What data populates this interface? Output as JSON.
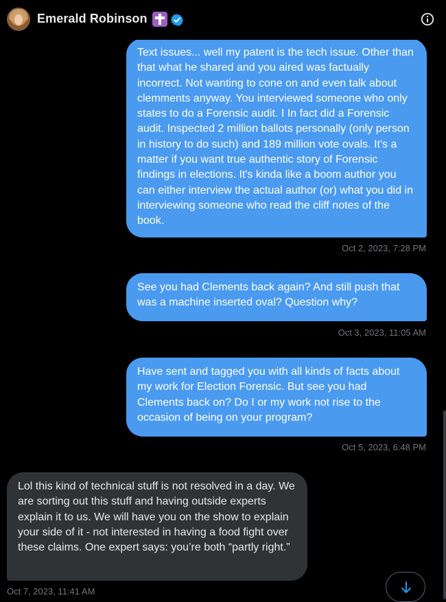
{
  "header": {
    "name": "Emerald Robinson",
    "badge_icon": "cross-icon",
    "verified_icon": "verified-badge-icon",
    "info_icon": "info-icon"
  },
  "messages": [
    {
      "direction": "sent",
      "text": "Text issues... well my patent is the tech issue.  Other than that what he shared and you aired was factually incorrect.  Not wanting to cone on and even talk about clemments anyway.  You interviewed someone who only states to do a Forensic audit.  I In fact did a Forensic audit. Inspected 2 million ballots personally (only person in history to do such) and 189 million vote ovals.  It's a matter if you want true authentic story of Forensic findings in elections. It's kinda like a boom author you can either interview the actual author (or) what you did in interviewing someone who read the cliff notes of the book.",
      "timestamp": "Oct 2, 2023, 7:28 PM"
    },
    {
      "direction": "sent",
      "text": "See you had Clements back again? And still push that was a machine inserted oval? Question why?",
      "timestamp": "Oct 3, 2023, 11:05 AM"
    },
    {
      "direction": "sent",
      "text": "Have sent and tagged you with all kinds of facts about my work for Election Forensic.  But see you had Clements back on? Do I or my work not rise to the occasion of being on your program?",
      "timestamp": "Oct 5, 2023, 6:48 PM"
    },
    {
      "direction": "received",
      "text": "Lol this kind of technical stuff is not resolved in a day. We are sorting out this stuff and having outside experts explain it to us. We will have you on the show to explain your side of it - not interested in having a food fight over these claims. One expert says: you’re both “partly right.”",
      "timestamp": "Oct 7, 2023, 11:41 AM"
    }
  ],
  "controls": {
    "scroll_down_icon": "arrow-down-icon"
  },
  "colors": {
    "background": "#000000",
    "sent_bubble": "#4a9af0",
    "received_bubble": "#2f3336",
    "timestamp": "#71767b",
    "verified": "#1d9bf0",
    "badge": "#9b5fc4"
  }
}
